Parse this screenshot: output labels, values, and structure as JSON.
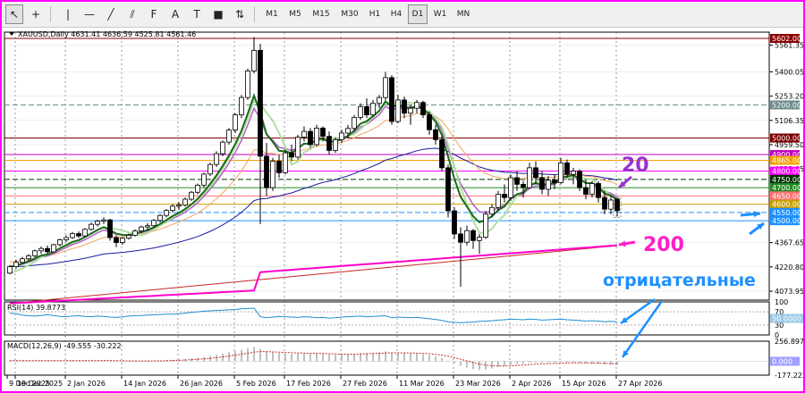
{
  "toolbar": {
    "tools": [
      {
        "name": "cursor-tool-icon",
        "glyph": "↖"
      },
      {
        "name": "crosshair-tool-icon",
        "glyph": "+"
      },
      {
        "name": "vertical-line-tool-icon",
        "glyph": "|"
      },
      {
        "name": "horizontal-line-tool-icon",
        "glyph": "—"
      },
      {
        "name": "trendline-tool-icon",
        "glyph": "╱"
      },
      {
        "name": "channel-tool-icon",
        "glyph": "⫽"
      },
      {
        "name": "fibonacci-tool-icon",
        "glyph": "F"
      },
      {
        "name": "text-tool-icon",
        "glyph": "A"
      },
      {
        "name": "text-label-tool-icon",
        "glyph": "T"
      },
      {
        "name": "rectangle-tool-icon",
        "glyph": "■"
      },
      {
        "name": "arrow-shapes-tool-icon",
        "glyph": "⇅"
      }
    ],
    "timeframes": [
      "M1",
      "M5",
      "M15",
      "M30",
      "H1",
      "H4",
      "D1",
      "W1",
      "MN"
    ],
    "active_timeframe": "D1"
  },
  "chart_data": [
    {
      "type": "candlestick",
      "title": "XAUUSD,Daily  4631.41 4636.59 4525.81 4561.46",
      "symbol": "XAUUSD",
      "timeframe": "Daily",
      "ohlc_header": {
        "open": 4631.41,
        "high": 4636.59,
        "low": 4525.81,
        "close": 4561.46
      },
      "ylim": [
        4020,
        5640
      ],
      "y_ticks": [
        "5561.35",
        "5400.05",
        "5253.20",
        "5106.35",
        "4959.50",
        "4812.65",
        "4367.65",
        "4220.80",
        "4073.95"
      ],
      "x_ticks": [
        "9 Dec 2025",
        "19 Dec 2025",
        "2 Jan 2026",
        "14 Jan 2026",
        "26 Jan 2026",
        "5 Feb 2026",
        "17 Feb 2026",
        "27 Feb 2026",
        "11 Mar 2026",
        "23 Mar 2026",
        "2 Apr 2026",
        "15 Apr 2026",
        "27 Apr 2026"
      ],
      "price_levels": [
        {
          "value": 5602.0,
          "label": "5602.00",
          "color": "#8b0000",
          "style": "solid"
        },
        {
          "value": 5200.0,
          "label": "5200.00",
          "color": "#6e8b8b",
          "style": "dashed"
        },
        {
          "value": 5000.0,
          "label": "5000.00",
          "color": "#7b0000",
          "style": "solid"
        },
        {
          "value": 4900.0,
          "label": "4900.00",
          "color": "#c000c0",
          "style": "solid"
        },
        {
          "value": 4865.0,
          "label": "4865.00",
          "color": "#f4a000",
          "style": "solid"
        },
        {
          "value": 4800.0,
          "label": "4800.00",
          "color": "#ff00ff",
          "style": "solid"
        },
        {
          "value": 4750.0,
          "label": "4750.00",
          "color": "#003300",
          "style": "dashed"
        },
        {
          "value": 4700.0,
          "label": "4700.00",
          "color": "#228b22",
          "style": "solid"
        },
        {
          "value": 4650.0,
          "label": "4650.00",
          "color": "#ff6f6f",
          "style": "solid"
        },
        {
          "value": 4600.0,
          "label": "4600.00",
          "color": "#c8a000",
          "style": "solid"
        },
        {
          "value": 4550.0,
          "label": "4550.00",
          "color": "#1e90ff",
          "style": "dashed"
        },
        {
          "value": 4500.0,
          "label": "4500.00",
          "color": "#1e90ff",
          "style": "solid"
        }
      ],
      "candles": [
        [
          4183,
          4232,
          4175,
          4222
        ],
        [
          4222,
          4265,
          4210,
          4248
        ],
        [
          4248,
          4282,
          4240,
          4270
        ],
        [
          4270,
          4298,
          4255,
          4288
        ],
        [
          4288,
          4325,
          4280,
          4318
        ],
        [
          4318,
          4345,
          4300,
          4332
        ],
        [
          4332,
          4350,
          4300,
          4312
        ],
        [
          4312,
          4360,
          4305,
          4355
        ],
        [
          4355,
          4392,
          4345,
          4385
        ],
        [
          4385,
          4412,
          4370,
          4398
        ],
        [
          4398,
          4432,
          4390,
          4422
        ],
        [
          4422,
          4435,
          4395,
          4408
        ],
        [
          4408,
          4455,
          4400,
          4448
        ],
        [
          4448,
          4490,
          4440,
          4478
        ],
        [
          4478,
          4505,
          4465,
          4498
        ],
        [
          4498,
          4520,
          4480,
          4505
        ],
        [
          4505,
          4512,
          4380,
          4398
        ],
        [
          4398,
          4412,
          4340,
          4368
        ],
        [
          4368,
          4402,
          4355,
          4395
        ],
        [
          4395,
          4422,
          4385,
          4412
        ],
        [
          4412,
          4448,
          4405,
          4438
        ],
        [
          4438,
          4470,
          4425,
          4462
        ],
        [
          4462,
          4485,
          4440,
          4470
        ],
        [
          4470,
          4510,
          4460,
          4502
        ],
        [
          4502,
          4540,
          4490,
          4532
        ],
        [
          4532,
          4570,
          4520,
          4562
        ],
        [
          4562,
          4600,
          4550,
          4588
        ],
        [
          4588,
          4612,
          4565,
          4595
        ],
        [
          4595,
          4640,
          4585,
          4630
        ],
        [
          4630,
          4680,
          4620,
          4672
        ],
        [
          4672,
          4725,
          4660,
          4715
        ],
        [
          4715,
          4790,
          4700,
          4782
        ],
        [
          4782,
          4850,
          4770,
          4840
        ],
        [
          4840,
          4920,
          4825,
          4905
        ],
        [
          4905,
          4985,
          4890,
          4975
        ],
        [
          4975,
          5060,
          4960,
          5048
        ],
        [
          5048,
          5150,
          5030,
          5140
        ],
        [
          5140,
          5260,
          5120,
          5245
        ],
        [
          5245,
          5420,
          5230,
          5405
        ],
        [
          5405,
          5610,
          5390,
          5530
        ],
        [
          5530,
          5570,
          4480,
          4890
        ],
        [
          4890,
          4970,
          4650,
          4700
        ],
        [
          4700,
          4880,
          4680,
          4860
        ],
        [
          4860,
          4900,
          4760,
          4790
        ],
        [
          4790,
          4930,
          4780,
          4910
        ],
        [
          4910,
          4960,
          4860,
          4885
        ],
        [
          4885,
          5020,
          4870,
          5005
        ],
        [
          5005,
          5070,
          4980,
          5040
        ],
        [
          5040,
          5060,
          4940,
          4960
        ],
        [
          4960,
          5080,
          4950,
          5060
        ],
        [
          5060,
          5070,
          4980,
          5010
        ],
        [
          5010,
          5040,
          4900,
          4925
        ],
        [
          4925,
          5005,
          4910,
          4990
        ],
        [
          4990,
          5050,
          4970,
          5030
        ],
        [
          5030,
          5080,
          5000,
          5058
        ],
        [
          5058,
          5140,
          5040,
          5125
        ],
        [
          5125,
          5210,
          5110,
          5190
        ],
        [
          5190,
          5240,
          5120,
          5140
        ],
        [
          5140,
          5230,
          5130,
          5210
        ],
        [
          5210,
          5260,
          5180,
          5245
        ],
        [
          5245,
          5400,
          5230,
          5365
        ],
        [
          5365,
          5380,
          5080,
          5100
        ],
        [
          5100,
          5260,
          5090,
          5230
        ],
        [
          5230,
          5250,
          5120,
          5150
        ],
        [
          5150,
          5200,
          5080,
          5180
        ],
        [
          5180,
          5230,
          5150,
          5215
        ],
        [
          5215,
          5225,
          5120,
          5140
        ],
        [
          5140,
          5160,
          5020,
          5050
        ],
        [
          5050,
          5080,
          4960,
          4990
        ],
        [
          4990,
          5010,
          4800,
          4820
        ],
        [
          4820,
          4840,
          4520,
          4560
        ],
        [
          4560,
          4580,
          4390,
          4420
        ],
        [
          4420,
          4460,
          4100,
          4370
        ],
        [
          4370,
          4470,
          4350,
          4440
        ],
        [
          4440,
          4450,
          4330,
          4380
        ],
        [
          4380,
          4420,
          4300,
          4400
        ],
        [
          4400,
          4560,
          4390,
          4540
        ],
        [
          4540,
          4600,
          4520,
          4580
        ],
        [
          4580,
          4680,
          4560,
          4660
        ],
        [
          4660,
          4720,
          4610,
          4640
        ],
        [
          4640,
          4780,
          4620,
          4760
        ],
        [
          4760,
          4800,
          4680,
          4720
        ],
        [
          4720,
          4740,
          4640,
          4700
        ],
        [
          4700,
          4850,
          4690,
          4820
        ],
        [
          4820,
          4860,
          4720,
          4760
        ],
        [
          4760,
          4800,
          4660,
          4690
        ],
        [
          4690,
          4770,
          4650,
          4745
        ],
        [
          4745,
          4780,
          4690,
          4730
        ],
        [
          4730,
          4880,
          4720,
          4850
        ],
        [
          4850,
          4870,
          4760,
          4780
        ],
        [
          4780,
          4820,
          4720,
          4800
        ],
        [
          4800,
          4810,
          4680,
          4700
        ],
        [
          4700,
          4750,
          4630,
          4660
        ],
        [
          4660,
          4740,
          4640,
          4725
        ],
        [
          4725,
          4740,
          4610,
          4640
        ],
        [
          4640,
          4680,
          4540,
          4570
        ],
        [
          4570,
          4650,
          4540,
          4625
        ],
        [
          4631,
          4637,
          4526,
          4561
        ]
      ],
      "annotations": [
        {
          "text": "20",
          "color": "#9b30d0"
        },
        {
          "text": "200",
          "color": "#ff1fc8"
        },
        {
          "text": "отрицательные",
          "color": "#1e90ff"
        }
      ]
    },
    {
      "type": "line",
      "title": "RSI(14) 39.8773",
      "indicator": "RSI",
      "period": 14,
      "current_value": 39.8773,
      "ylim": [
        0,
        100
      ],
      "y_ticks": [
        "100",
        "70",
        "30",
        "0"
      ],
      "levels": [
        70,
        30
      ],
      "value_label": "50.0000",
      "values": [
        66,
        64,
        60,
        58,
        57,
        59,
        61,
        59,
        56,
        55,
        57,
        58,
        56,
        55,
        57,
        56,
        54,
        53,
        55,
        57,
        58,
        59,
        60,
        61,
        62,
        63,
        63,
        64,
        66,
        68,
        70,
        72,
        73,
        74,
        75,
        76,
        77,
        79,
        80,
        81,
        55,
        52,
        54,
        56,
        55,
        54,
        53,
        55,
        54,
        52,
        53,
        51,
        52,
        54,
        55,
        56,
        57,
        55,
        56,
        57,
        58,
        52,
        54,
        53,
        52,
        53,
        51,
        49,
        47,
        44,
        40,
        38,
        37,
        38,
        39,
        41,
        42,
        43,
        45,
        46,
        48,
        47,
        46,
        48,
        47,
        45,
        46,
        47,
        48,
        46,
        45,
        44,
        42,
        43,
        42,
        40,
        41,
        39.88
      ]
    },
    {
      "type": "bar",
      "title": "MACD(12,26,9) -49.555 -30.222",
      "indicator": "MACD",
      "params": "12,26,9",
      "macd_value": -49.555,
      "signal_value": -30.222,
      "ylim": [
        -177.222,
        256.897
      ],
      "y_ticks": [
        "256.897",
        "0.000",
        "-177.222"
      ],
      "values": [
        8,
        9,
        9,
        8,
        8,
        8,
        8,
        7,
        8,
        9,
        10,
        10,
        9,
        9,
        10,
        10,
        6,
        3,
        2,
        2,
        3,
        4,
        5,
        7,
        10,
        14,
        18,
        24,
        30,
        38,
        46,
        56,
        68,
        82,
        98,
        115,
        132,
        150,
        170,
        185,
        160,
        130,
        118,
        105,
        100,
        95,
        98,
        100,
        95,
        97,
        92,
        86,
        85,
        86,
        88,
        94,
        104,
        108,
        110,
        114,
        126,
        112,
        110,
        104,
        98,
        96,
        88,
        76,
        62,
        40,
        8,
        -24,
        -58,
        -80,
        -100,
        -112,
        -106,
        -92,
        -74,
        -62,
        -46,
        -34,
        -28,
        -18,
        -16,
        -18,
        -16,
        -17,
        -12,
        -14,
        -15,
        -20,
        -26,
        -28,
        -32,
        -40,
        -44,
        -49.555
      ],
      "signal": [
        8,
        8,
        9,
        9,
        8,
        8,
        8,
        8,
        8,
        8,
        9,
        9,
        9,
        9,
        9,
        10,
        9,
        8,
        7,
        5,
        4,
        4,
        4,
        5,
        6,
        8,
        10,
        13,
        16,
        20,
        25,
        31,
        38,
        47,
        56,
        67,
        78,
        90,
        103,
        117,
        124,
        123,
        120,
        117,
        113,
        109,
        107,
        105,
        103,
        101,
        99,
        96,
        94,
        92,
        91,
        91,
        93,
        96,
        99,
        102,
        106,
        108,
        108,
        108,
        106,
        104,
        101,
        96,
        89,
        79,
        65,
        47,
        26,
        5,
        -16,
        -35,
        -49,
        -57,
        -61,
        -61,
        -58,
        -53,
        -48,
        -42,
        -37,
        -33,
        -30,
        -27,
        -24,
        -22,
        -20,
        -20,
        -21,
        -22,
        -24,
        -27,
        -30,
        -30.222
      ]
    }
  ]
}
